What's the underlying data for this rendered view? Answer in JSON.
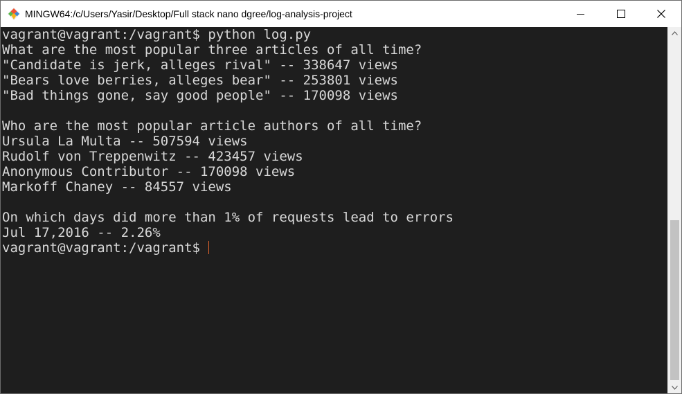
{
  "window": {
    "title": "MINGW64:/c/Users/Yasir/Desktop/Full stack nano dgree/log-analysis-project",
    "app_icon": "git-diamond-icon",
    "controls": [
      "minimize-icon",
      "maximize-icon",
      "close-icon"
    ]
  },
  "terminal": {
    "lines": [
      "vagrant@vagrant:/vagrant$ python log.py",
      "What are the most popular three articles of all time?",
      "\"Candidate is jerk, alleges rival\" -- 338647 views",
      "\"Bears love berries, alleges bear\" -- 253801 views",
      "\"Bad things gone, say good people\" -- 170098 views",
      "",
      "Who are the most popular article authors of all time?",
      "Ursula La Multa -- 507594 views",
      "Rudolf von Treppenwitz -- 423457 views",
      "Anonymous Contributor -- 170098 views",
      "Markoff Chaney -- 84557 views",
      "",
      "On which days did more than 1% of requests lead to errors",
      "Jul 17,2016 -- 2.26%"
    ],
    "prompt": "vagrant@vagrant:/vagrant$",
    "cursor_color": "#e0642d",
    "text_color": "#d8d8d8",
    "background_color": "#1e1e1e"
  },
  "scrollbar": {
    "up_icon": "scroll-up-arrow-icon",
    "down_icon": "scroll-down-arrow-icon"
  }
}
